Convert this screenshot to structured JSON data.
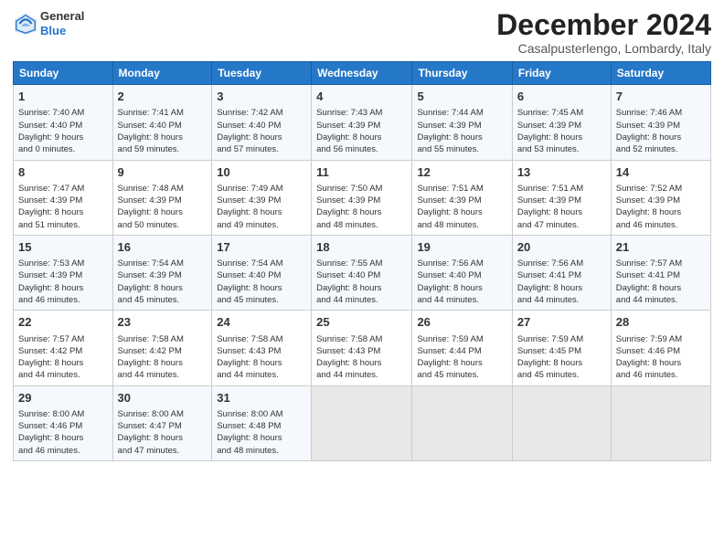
{
  "header": {
    "logo_general": "General",
    "logo_blue": "Blue",
    "title": "December 2024",
    "location": "Casalpusterlengo, Lombardy, Italy"
  },
  "weekdays": [
    "Sunday",
    "Monday",
    "Tuesday",
    "Wednesday",
    "Thursday",
    "Friday",
    "Saturday"
  ],
  "weeks": [
    [
      {
        "day": "1",
        "detail": "Sunrise: 7:40 AM\nSunset: 4:40 PM\nDaylight: 9 hours\nand 0 minutes."
      },
      {
        "day": "2",
        "detail": "Sunrise: 7:41 AM\nSunset: 4:40 PM\nDaylight: 8 hours\nand 59 minutes."
      },
      {
        "day": "3",
        "detail": "Sunrise: 7:42 AM\nSunset: 4:40 PM\nDaylight: 8 hours\nand 57 minutes."
      },
      {
        "day": "4",
        "detail": "Sunrise: 7:43 AM\nSunset: 4:39 PM\nDaylight: 8 hours\nand 56 minutes."
      },
      {
        "day": "5",
        "detail": "Sunrise: 7:44 AM\nSunset: 4:39 PM\nDaylight: 8 hours\nand 55 minutes."
      },
      {
        "day": "6",
        "detail": "Sunrise: 7:45 AM\nSunset: 4:39 PM\nDaylight: 8 hours\nand 53 minutes."
      },
      {
        "day": "7",
        "detail": "Sunrise: 7:46 AM\nSunset: 4:39 PM\nDaylight: 8 hours\nand 52 minutes."
      }
    ],
    [
      {
        "day": "8",
        "detail": "Sunrise: 7:47 AM\nSunset: 4:39 PM\nDaylight: 8 hours\nand 51 minutes."
      },
      {
        "day": "9",
        "detail": "Sunrise: 7:48 AM\nSunset: 4:39 PM\nDaylight: 8 hours\nand 50 minutes."
      },
      {
        "day": "10",
        "detail": "Sunrise: 7:49 AM\nSunset: 4:39 PM\nDaylight: 8 hours\nand 49 minutes."
      },
      {
        "day": "11",
        "detail": "Sunrise: 7:50 AM\nSunset: 4:39 PM\nDaylight: 8 hours\nand 48 minutes."
      },
      {
        "day": "12",
        "detail": "Sunrise: 7:51 AM\nSunset: 4:39 PM\nDaylight: 8 hours\nand 48 minutes."
      },
      {
        "day": "13",
        "detail": "Sunrise: 7:51 AM\nSunset: 4:39 PM\nDaylight: 8 hours\nand 47 minutes."
      },
      {
        "day": "14",
        "detail": "Sunrise: 7:52 AM\nSunset: 4:39 PM\nDaylight: 8 hours\nand 46 minutes."
      }
    ],
    [
      {
        "day": "15",
        "detail": "Sunrise: 7:53 AM\nSunset: 4:39 PM\nDaylight: 8 hours\nand 46 minutes."
      },
      {
        "day": "16",
        "detail": "Sunrise: 7:54 AM\nSunset: 4:39 PM\nDaylight: 8 hours\nand 45 minutes."
      },
      {
        "day": "17",
        "detail": "Sunrise: 7:54 AM\nSunset: 4:40 PM\nDaylight: 8 hours\nand 45 minutes."
      },
      {
        "day": "18",
        "detail": "Sunrise: 7:55 AM\nSunset: 4:40 PM\nDaylight: 8 hours\nand 44 minutes."
      },
      {
        "day": "19",
        "detail": "Sunrise: 7:56 AM\nSunset: 4:40 PM\nDaylight: 8 hours\nand 44 minutes."
      },
      {
        "day": "20",
        "detail": "Sunrise: 7:56 AM\nSunset: 4:41 PM\nDaylight: 8 hours\nand 44 minutes."
      },
      {
        "day": "21",
        "detail": "Sunrise: 7:57 AM\nSunset: 4:41 PM\nDaylight: 8 hours\nand 44 minutes."
      }
    ],
    [
      {
        "day": "22",
        "detail": "Sunrise: 7:57 AM\nSunset: 4:42 PM\nDaylight: 8 hours\nand 44 minutes."
      },
      {
        "day": "23",
        "detail": "Sunrise: 7:58 AM\nSunset: 4:42 PM\nDaylight: 8 hours\nand 44 minutes."
      },
      {
        "day": "24",
        "detail": "Sunrise: 7:58 AM\nSunset: 4:43 PM\nDaylight: 8 hours\nand 44 minutes."
      },
      {
        "day": "25",
        "detail": "Sunrise: 7:58 AM\nSunset: 4:43 PM\nDaylight: 8 hours\nand 44 minutes."
      },
      {
        "day": "26",
        "detail": "Sunrise: 7:59 AM\nSunset: 4:44 PM\nDaylight: 8 hours\nand 45 minutes."
      },
      {
        "day": "27",
        "detail": "Sunrise: 7:59 AM\nSunset: 4:45 PM\nDaylight: 8 hours\nand 45 minutes."
      },
      {
        "day": "28",
        "detail": "Sunrise: 7:59 AM\nSunset: 4:46 PM\nDaylight: 8 hours\nand 46 minutes."
      }
    ],
    [
      {
        "day": "29",
        "detail": "Sunrise: 8:00 AM\nSunset: 4:46 PM\nDaylight: 8 hours\nand 46 minutes."
      },
      {
        "day": "30",
        "detail": "Sunrise: 8:00 AM\nSunset: 4:47 PM\nDaylight: 8 hours\nand 47 minutes."
      },
      {
        "day": "31",
        "detail": "Sunrise: 8:00 AM\nSunset: 4:48 PM\nDaylight: 8 hours\nand 48 minutes."
      },
      {
        "day": "",
        "detail": ""
      },
      {
        "day": "",
        "detail": ""
      },
      {
        "day": "",
        "detail": ""
      },
      {
        "day": "",
        "detail": ""
      }
    ]
  ]
}
